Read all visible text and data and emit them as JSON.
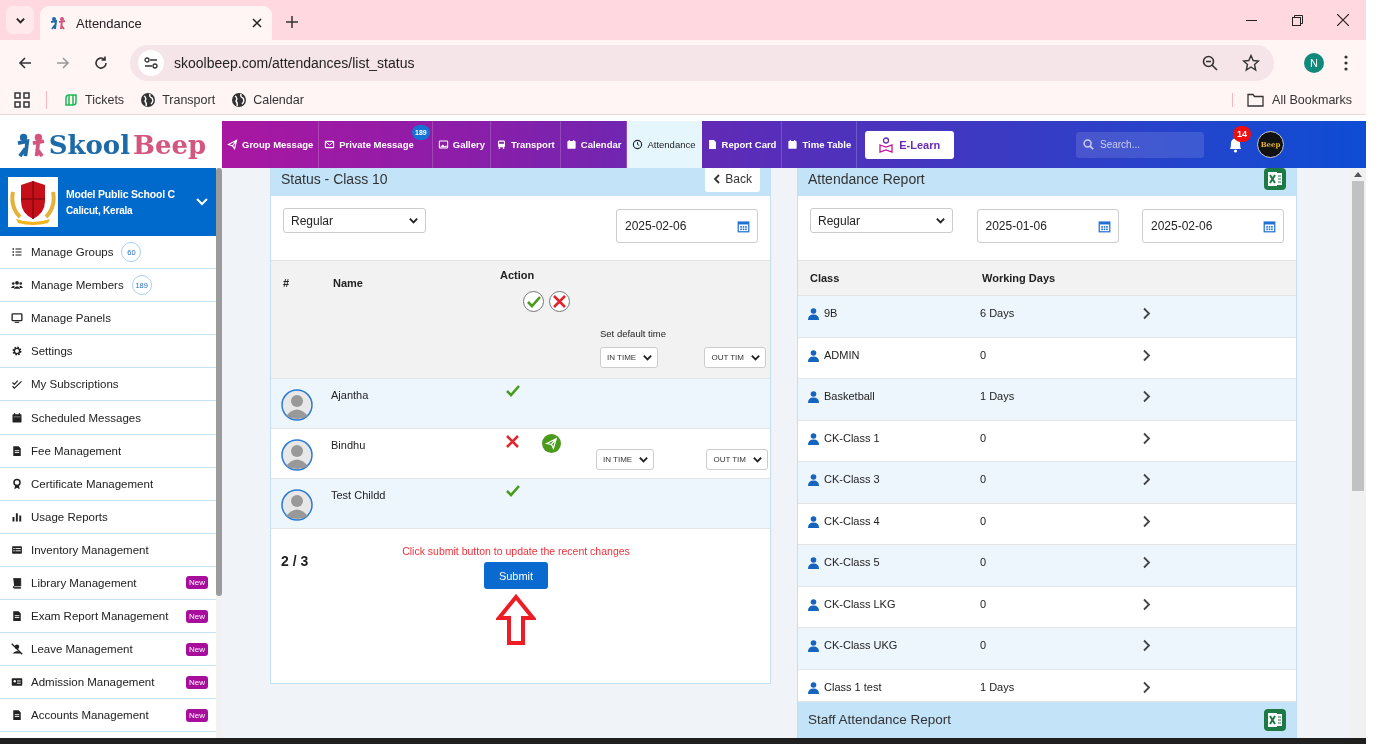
{
  "browser": {
    "tab_title": "Attendance",
    "url": "skoolbeep.com/attendances/list_status",
    "profile_initial": "N",
    "bookmarks": [
      {
        "label": "Tickets",
        "kind": "ticket"
      },
      {
        "label": "Transport",
        "kind": "globe"
      },
      {
        "label": "Calendar",
        "kind": "globe"
      }
    ],
    "all_bookmarks": "All Bookmarks"
  },
  "header": {
    "logo_first": "Skool",
    "logo_second": "Beep",
    "nav": [
      {
        "label": "Group Message",
        "kind": "plane",
        "selected": false
      },
      {
        "label": "Private Message",
        "kind": "envelope",
        "selected": false,
        "badge": "189"
      },
      {
        "label": "Gallery",
        "kind": "image",
        "selected": false
      },
      {
        "label": "Transport",
        "kind": "bus",
        "selected": false
      },
      {
        "label": "Calendar",
        "kind": "calendar",
        "selected": false
      },
      {
        "label": "Attendance",
        "kind": "clock",
        "selected": true
      },
      {
        "label": "Report Card",
        "kind": "document",
        "selected": false
      },
      {
        "label": "Time Table",
        "kind": "calendar",
        "selected": false
      }
    ],
    "elearn": "E-Learn",
    "search_placeholder": "Search...",
    "notifications": "14",
    "avatar_text": "Beep"
  },
  "sidebar": {
    "school": "Model Public School C",
    "location": "Calicut, Kerala",
    "items": [
      {
        "label": "Manage Groups",
        "kind": "list",
        "count": "60"
      },
      {
        "label": "Manage Members",
        "kind": "people",
        "count": "189"
      },
      {
        "label": "Manage Panels",
        "kind": "monitor"
      },
      {
        "label": "Settings",
        "kind": "gear"
      },
      {
        "label": "My Subscriptions",
        "kind": "check"
      },
      {
        "label": "Scheduled Messages",
        "kind": "calendar"
      },
      {
        "label": "Fee Management",
        "kind": "document"
      },
      {
        "label": "Certificate Management",
        "kind": "medal"
      },
      {
        "label": "Usage Reports",
        "kind": "bars"
      },
      {
        "label": "Inventory Management",
        "kind": "table"
      },
      {
        "label": "Library Management",
        "kind": "book",
        "badge": "New"
      },
      {
        "label": "Exam Report Management",
        "kind": "document",
        "badge": "New"
      },
      {
        "label": "Leave Management",
        "kind": "person-slash",
        "badge": "New"
      },
      {
        "label": "Admission Management",
        "kind": "id-card",
        "badge": "New"
      },
      {
        "label": "Accounts Management",
        "kind": "document",
        "badge": "New"
      }
    ]
  },
  "status_panel": {
    "title": "Status - Class 10",
    "back": "Back",
    "type": "Regular",
    "date": "2025-02-06",
    "columns": [
      "#",
      "Name",
      "Action"
    ],
    "default_time_label": "Set default time",
    "default_in": "IN TIME",
    "default_out": "OUT TIM",
    "rows": [
      {
        "name": "Ajantha",
        "present": true
      },
      {
        "name": "Bindhu",
        "present": false,
        "in_time": "IN TIME",
        "out_time": "OUT TIM"
      },
      {
        "name": "Test Childd",
        "present": true
      }
    ],
    "count": "2 / 3",
    "notice": "Click submit button to update the recent changes",
    "submit": "Submit"
  },
  "report_panel": {
    "title": "Attendance Report",
    "type": "Regular",
    "from": "2025-01-06",
    "to": "2025-02-06",
    "columns": [
      "Class",
      "Working Days"
    ],
    "rows": [
      {
        "class": "9B",
        "days": "6 Days"
      },
      {
        "class": "ADMIN",
        "days": "0"
      },
      {
        "class": "Basketball",
        "days": "1 Days"
      },
      {
        "class": "CK-Class 1",
        "days": "0"
      },
      {
        "class": "CK-Class 3",
        "days": "0"
      },
      {
        "class": "CK-Class 4",
        "days": "0"
      },
      {
        "class": "CK-Class 5",
        "days": "0"
      },
      {
        "class": "CK-Class LKG",
        "days": "0"
      },
      {
        "class": "CK-Class UKG",
        "days": "0"
      },
      {
        "class": "Class 1 test",
        "days": "1 Days"
      }
    ],
    "staff_title": "Staff Attendance Report"
  }
}
